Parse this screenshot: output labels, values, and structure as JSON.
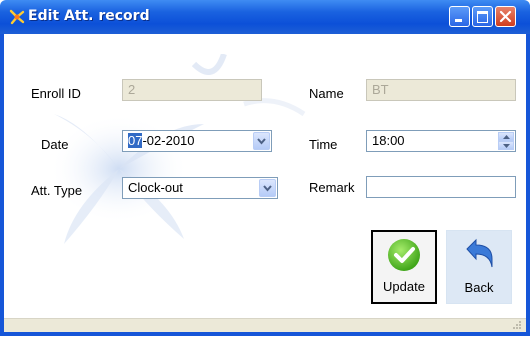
{
  "window": {
    "title": "Edit Att. record",
    "controls": [
      "minimize",
      "maximize",
      "close"
    ]
  },
  "form": {
    "enroll_id_label": "Enroll ID",
    "enroll_id_value": "2",
    "name_label": "Name",
    "name_value": "BT",
    "date_label": "Date",
    "date_value_selected": "07",
    "date_value_rest": "-02-2010",
    "time_label": "Time",
    "time_value": "18:00",
    "att_type_label": "Att. Type",
    "att_type_value": "Clock-out",
    "remark_label": "Remark",
    "remark_value": ""
  },
  "buttons": {
    "update_label": "Update",
    "back_label": "Back"
  },
  "icons": {
    "update": "checkmark-icon",
    "back": "back-arrow-icon",
    "title": "app-icon"
  },
  "colors": {
    "titlebar": "#0c50d8",
    "update_icon": "#5cc22e",
    "back_icon": "#3b7ad8"
  }
}
